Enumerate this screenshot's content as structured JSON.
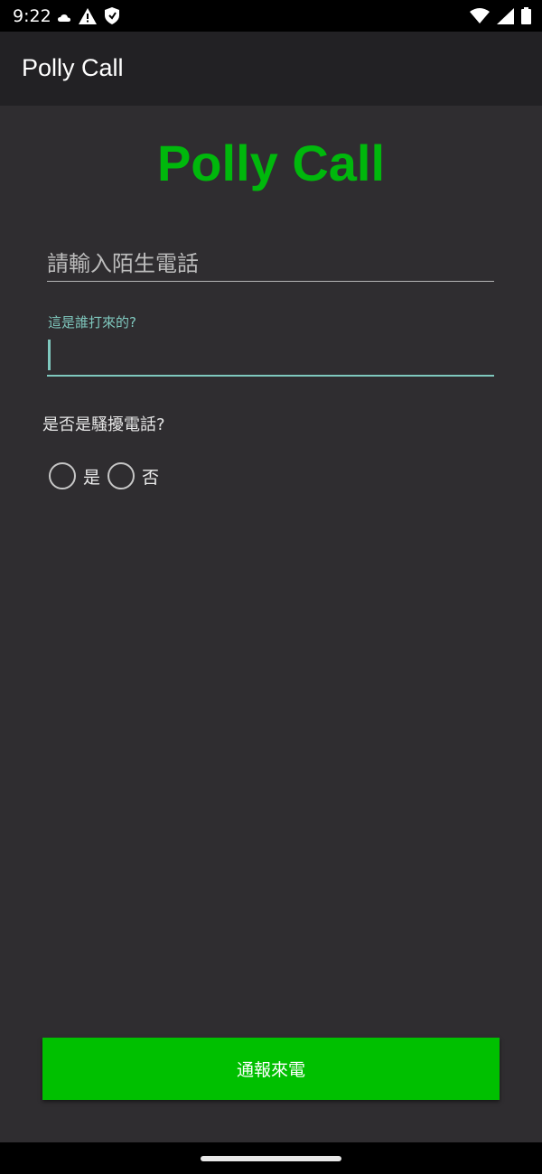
{
  "status_bar": {
    "time": "9:22",
    "left_icons": [
      "cloud-icon",
      "warning-icon",
      "shield-icon"
    ],
    "right_icons": [
      "wifi-icon",
      "signal-icon",
      "battery-icon"
    ]
  },
  "app_bar": {
    "title": "Polly Call"
  },
  "main": {
    "heading": "Polly Call",
    "phone_input": {
      "placeholder": "請輸入陌生電話",
      "value": ""
    },
    "caller_input": {
      "label": "這是誰打來的?",
      "value": ""
    },
    "spam_question": "是否是騷擾電話?",
    "spam_options": [
      {
        "label": "是",
        "selected": false
      },
      {
        "label": "否",
        "selected": false
      }
    ],
    "submit_label": "通報來電"
  },
  "colors": {
    "accent_green": "#00b80c",
    "button_green": "#00c000",
    "field_focus": "#7fc8be",
    "background": "#2f2d30",
    "app_bar": "#222124"
  }
}
